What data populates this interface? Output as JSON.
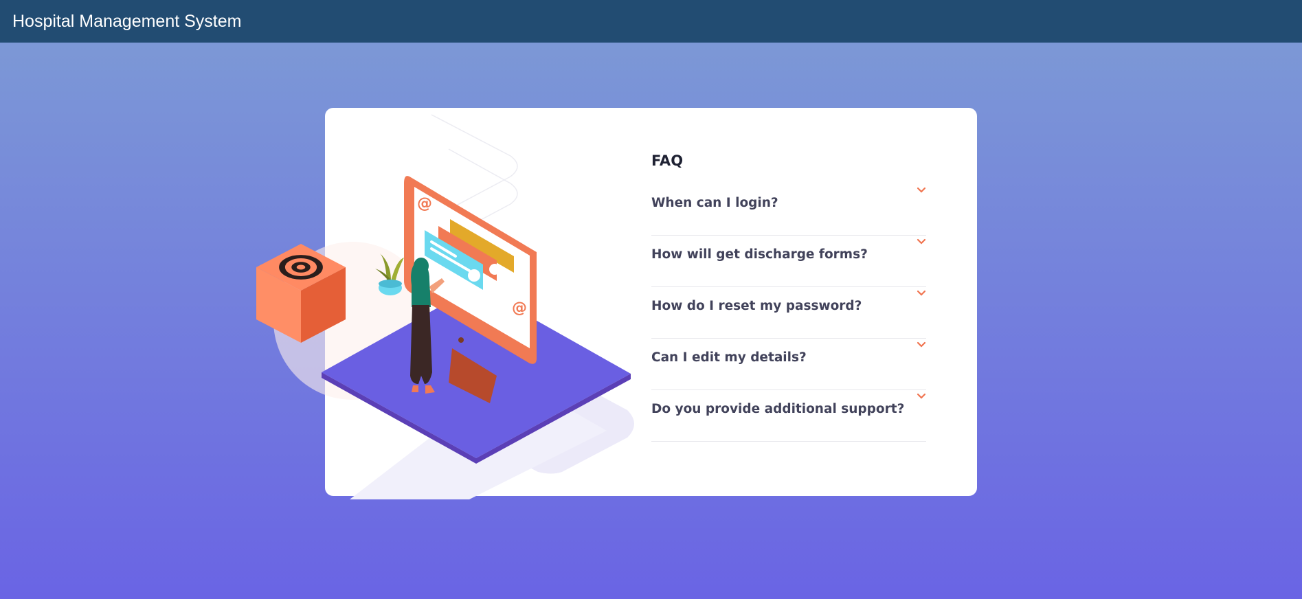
{
  "header": {
    "title": "Hospital Management System"
  },
  "faq": {
    "title": "FAQ",
    "items": [
      {
        "question": "When can I login?",
        "icon": "chevron-down-icon"
      },
      {
        "question": "How will get discharge forms?",
        "icon": "chevron-down-icon"
      },
      {
        "question": "How do I reset my password?",
        "icon": "chevron-down-icon"
      },
      {
        "question": "Can I edit my details?",
        "icon": "chevron-down-icon"
      },
      {
        "question": "Do you provide additional support?",
        "icon": "chevron-down-icon"
      }
    ]
  },
  "colors": {
    "header_bg": "#224c72",
    "page_gradient_top": "#7c98d6",
    "page_gradient_bottom": "#6a64e4",
    "accent": "#f0734e",
    "question_text": "#41425a"
  }
}
